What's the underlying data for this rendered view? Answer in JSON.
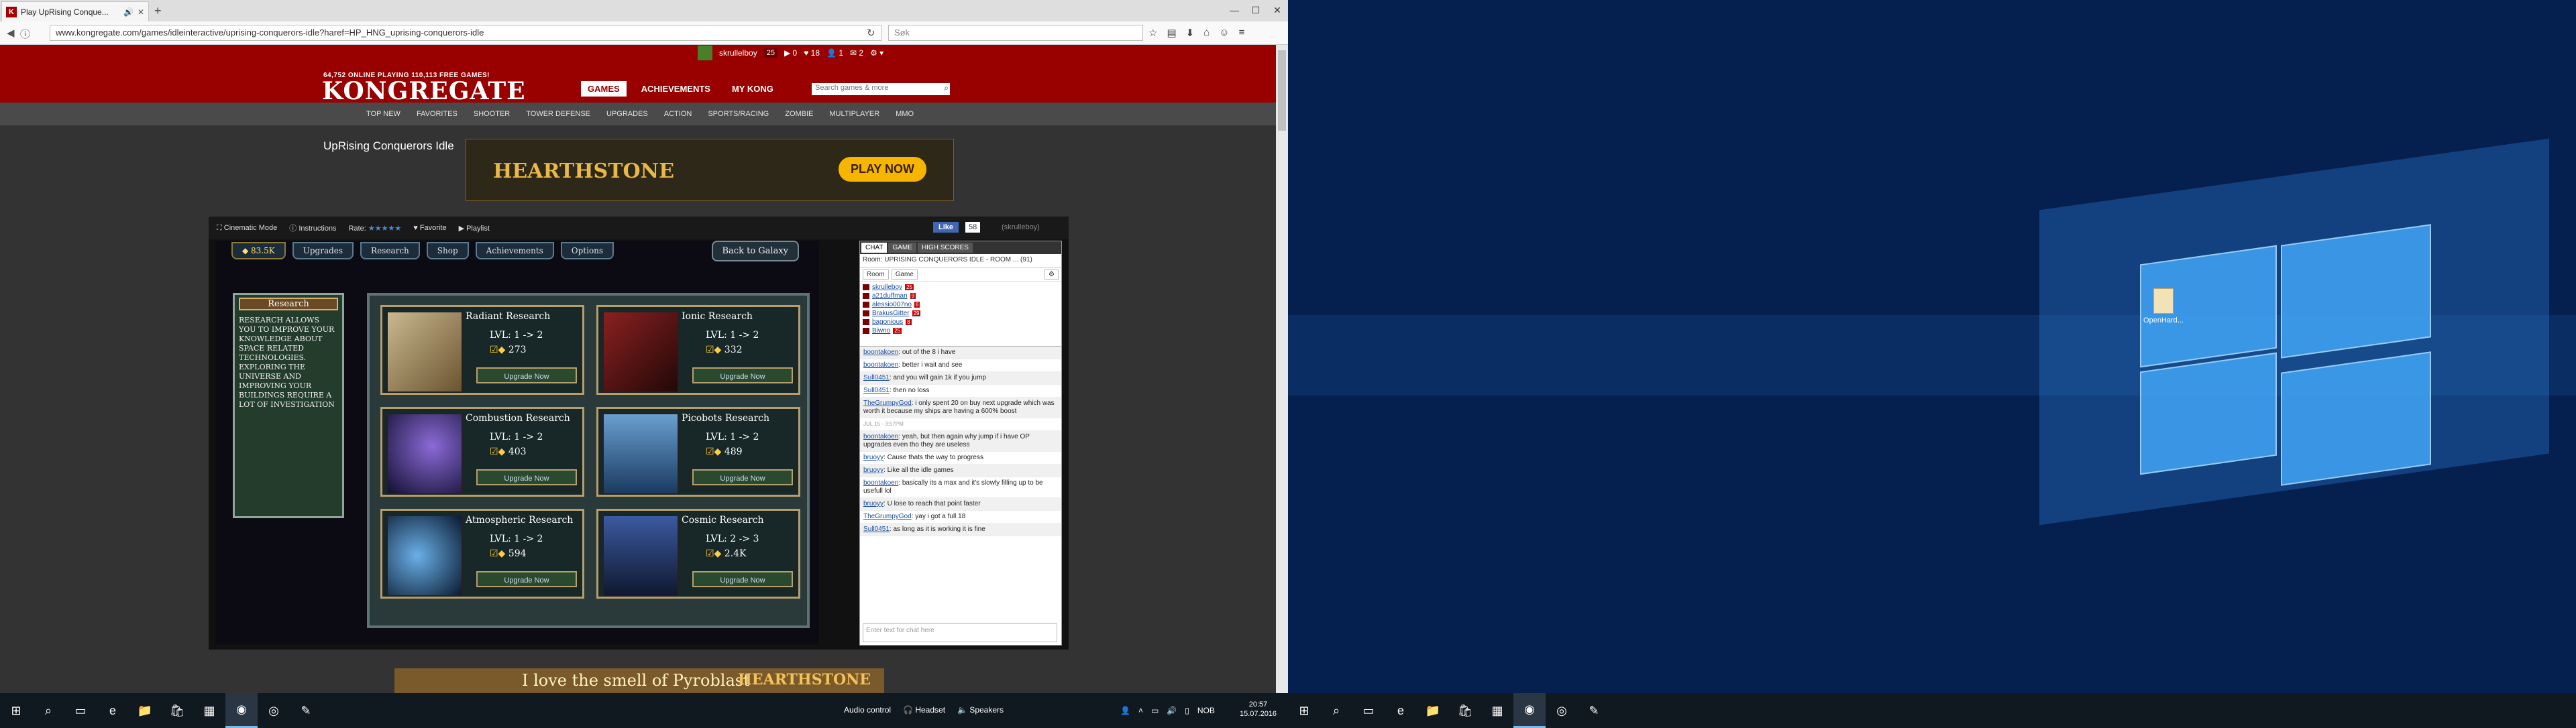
{
  "browser": {
    "tab_title": "Play UpRising Conque...",
    "tab_favicon": "K",
    "url": "www.kongregate.com/games/idleinteractive/uprising-conquerors-idle?haref=HP_HNG_uprising-conquerors-idle",
    "search_placeholder": "Søk"
  },
  "kong": {
    "username": "skrullelboy",
    "user_level": "25",
    "counts": [
      "0",
      "18",
      "1",
      "2"
    ],
    "tagline": "64,752 ONLINE PLAYING 110,113 FREE GAMES!",
    "logo": "KONGREGATE",
    "nav": [
      "GAMES",
      "ACHIEVEMENTS",
      "MY KONG"
    ],
    "search_placeholder": "Search games & more",
    "subnav": [
      "TOP NEW",
      "FAVORITES",
      "SHOOTER",
      "TOWER DEFENSE",
      "UPGRADES",
      "ACTION",
      "SPORTS/RACING",
      "ZOMBIE",
      "MULTIPLAYER",
      "MMO"
    ],
    "game_title": "UpRising Conquerors Idle",
    "ad_brand": "HEARTHSTONE",
    "ad_button": "PLAY NOW"
  },
  "gamebar": {
    "cinematic": "Cinematic Mode",
    "instructions": "Instructions",
    "rate": "Rate:",
    "favorite": "Favorite",
    "playlist": "Playlist",
    "like": "Like",
    "like_count": "58",
    "user": "(skrulleboy)"
  },
  "game": {
    "resource": "83.5K",
    "tabs": [
      "Upgrades",
      "Research",
      "Shop",
      "Achievements",
      "Options"
    ],
    "back": "Back to Galaxy",
    "panel_title": "Research",
    "panel_text": "Research allows you to improve your knowledge about space related technologies. Exploring the universe and improving your buildings require a lot of investigation",
    "cards": [
      {
        "name": "Radiant Research",
        "level": "LVL: 1 -> 2",
        "cost": "273",
        "button": "Upgrade Now"
      },
      {
        "name": "Ionic Research",
        "level": "LVL: 1 -> 2",
        "cost": "332",
        "button": "Upgrade Now"
      },
      {
        "name": "Combustion Research",
        "level": "LVL: 1 -> 2",
        "cost": "403",
        "button": "Upgrade Now"
      },
      {
        "name": "Picobots Research",
        "level": "LVL: 1 -> 2",
        "cost": "489",
        "button": "Upgrade Now"
      },
      {
        "name": "Atmospheric Research",
        "level": "LVL: 1 -> 2",
        "cost": "594",
        "button": "Upgrade Now"
      },
      {
        "name": "Cosmic Research",
        "level": "LVL: 2 -> 3",
        "cost": "2.4K",
        "button": "Upgrade Now"
      }
    ]
  },
  "chat": {
    "tabs": [
      "CHAT",
      "GAME",
      "HIGH SCORES"
    ],
    "room": "Room: UPRISING CONQUERORS IDLE - ROOM ... (91)",
    "subtabs": [
      "Room",
      "Game"
    ],
    "users": [
      {
        "name": "skrulleboy",
        "lvl": "25"
      },
      {
        "name": "a21duffman",
        "lvl": "9"
      },
      {
        "name": "alessio007no",
        "lvl": "6"
      },
      {
        "name": "BrakusGitter",
        "lvl": "29"
      },
      {
        "name": "bagonious",
        "lvl": "8"
      },
      {
        "name": "Biwno",
        "lvl": "25"
      }
    ],
    "messages": [
      {
        "user": "boontakoen",
        "text": ": out of the 8 i have"
      },
      {
        "user": "boontakoen",
        "text": ": better i wait and see"
      },
      {
        "user": "Sull0451",
        "text": ": and you will gain 1k if you jump"
      },
      {
        "user": "Sull0451",
        "text": ": then no loss"
      },
      {
        "user": "TheGrumpyGod",
        "text": ": i only spent 20 on buy next upgrade which was worth it because my ships are having a 600% boost"
      },
      {
        "user": "",
        "text": "JUL 15 - 3:57PM"
      },
      {
        "user": "boontakoen",
        "text": ": yeah, but then again why jump if i have OP upgrades even tho they are useless"
      },
      {
        "user": "bruoyy",
        "text": ": Cause thats the way to progress"
      },
      {
        "user": "bruoyy",
        "text": ": Like all the idle games"
      },
      {
        "user": "boontakoen",
        "text": ": basically its a max and it's slowly filling up to be usefull lol"
      },
      {
        "user": "bruoyy",
        "text": ": U lose to reach that point faster"
      },
      {
        "user": "TheGrumpyGod",
        "text": ": yay i got a full 18"
      },
      {
        "user": "Sull0451",
        "text": ": as long as it is working it is fine"
      }
    ],
    "input_placeholder": "Enter text for chat here"
  },
  "bottom_ad": {
    "text": "I love the smell of Pyroblast",
    "brand": "HEARTHSTONE"
  },
  "desktop": {
    "icon_label": "OpenHard..."
  },
  "taskbar": {
    "audio_label": "Audio control",
    "headset": "Headset",
    "speakers": "Speakers",
    "lang": "NOB",
    "time": "20:57",
    "date": "15.07.2016"
  }
}
